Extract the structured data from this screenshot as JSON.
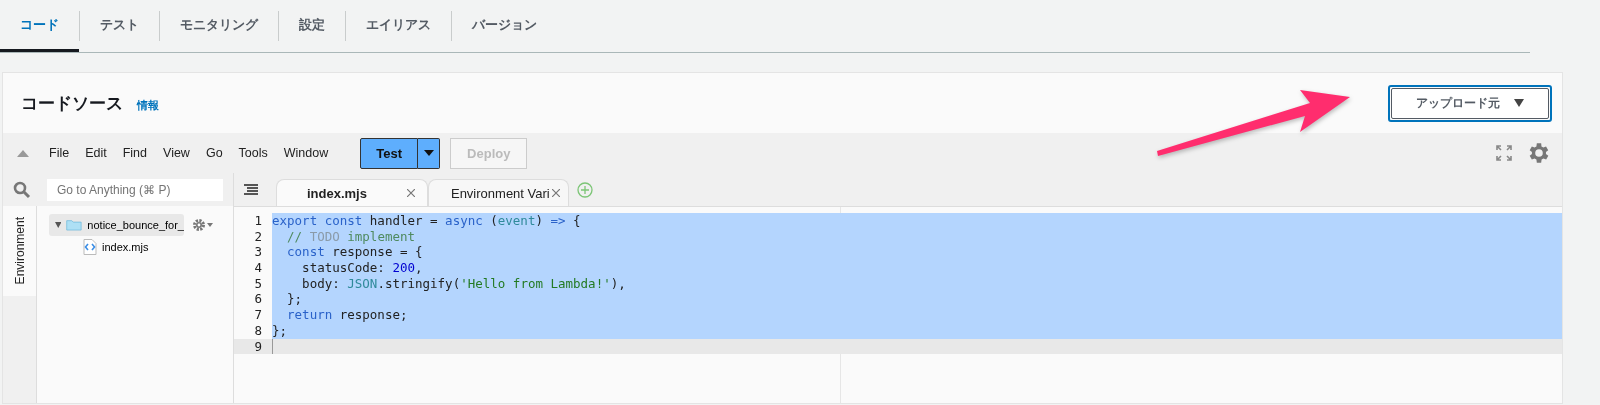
{
  "tabs": [
    {
      "label": "コード",
      "selected": true
    },
    {
      "label": "テスト",
      "selected": false
    },
    {
      "label": "モニタリング",
      "selected": false
    },
    {
      "label": "設定",
      "selected": false
    },
    {
      "label": "エイリアス",
      "selected": false
    },
    {
      "label": "バージョン",
      "selected": false
    }
  ],
  "panel": {
    "title": "コードソース",
    "info_link": "情報",
    "upload_button": "アップロード元"
  },
  "ide": {
    "menu": [
      "File",
      "Edit",
      "Find",
      "View",
      "Go",
      "Tools",
      "Window"
    ],
    "test_button": "Test",
    "deploy_button": {
      "label": "Deploy",
      "disabled": true
    },
    "search": {
      "placeholder": "Go to Anything (⌘ P)"
    },
    "side_tab": "Environment",
    "tree": [
      {
        "label": "notice_bounce_for_",
        "kind": "folder",
        "selected": true,
        "expanded": true,
        "children": [
          {
            "label": "index.mjs",
            "kind": "file",
            "selected": false
          }
        ]
      }
    ],
    "editor_tabs": [
      {
        "label": "index.mjs",
        "selected": true
      },
      {
        "label": "Environment Vari",
        "selected": false
      }
    ],
    "code": [
      {
        "number": "1",
        "selected": true,
        "tokens": [
          {
            "t": "export const ",
            "kind": "kw"
          },
          {
            "t": "handler = ",
            "kind": "plain"
          },
          {
            "t": "async ",
            "kind": "kw"
          },
          {
            "t": "(",
            "kind": "plain"
          },
          {
            "t": "event",
            "kind": "ident"
          },
          {
            "t": ") ",
            "kind": "plain"
          },
          {
            "t": "=> ",
            "kind": "kw"
          },
          {
            "t": "{",
            "kind": "plain"
          }
        ]
      },
      {
        "number": "2",
        "selected": true,
        "tokens": [
          {
            "t": "  // ",
            "kind": "comment"
          },
          {
            "t": "TODO",
            "kind": "todo"
          },
          {
            "t": " implement",
            "kind": "comment"
          }
        ]
      },
      {
        "number": "3",
        "selected": true,
        "tokens": [
          {
            "t": "  const ",
            "kind": "kw"
          },
          {
            "t": "response = {",
            "kind": "plain"
          }
        ]
      },
      {
        "number": "4",
        "selected": true,
        "tokens": [
          {
            "t": "    statusCode: ",
            "kind": "plain"
          },
          {
            "t": "200",
            "kind": "num"
          },
          {
            "t": ",",
            "kind": "plain"
          }
        ]
      },
      {
        "number": "5",
        "selected": true,
        "tokens": [
          {
            "t": "    body: ",
            "kind": "plain"
          },
          {
            "t": "JSON",
            "kind": "ident"
          },
          {
            "t": ".stringify(",
            "kind": "plain"
          },
          {
            "t": "'Hello from Lambda!'",
            "kind": "str"
          },
          {
            "t": "),",
            "kind": "plain"
          }
        ]
      },
      {
        "number": "6",
        "selected": true,
        "tokens": [
          {
            "t": "  };",
            "kind": "plain"
          }
        ]
      },
      {
        "number": "7",
        "selected": true,
        "tokens": [
          {
            "t": "  return ",
            "kind": "kw"
          },
          {
            "t": "response;",
            "kind": "plain"
          }
        ]
      },
      {
        "number": "8",
        "selected": true,
        "tokens": [
          {
            "t": "};",
            "kind": "plain"
          }
        ]
      },
      {
        "number": "9",
        "selected": false
      }
    ]
  }
}
